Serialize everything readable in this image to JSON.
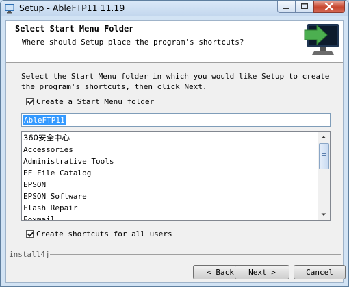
{
  "window": {
    "title": "Setup - AbleFTP11 11.19"
  },
  "header": {
    "title": "Select Start Menu Folder",
    "subtitle": "Where should Setup place the program's shortcuts?",
    "icon": "monitor-arrow-icon"
  },
  "body": {
    "description": "Select the Start Menu folder in which you would like Setup to create the program's shortcuts, then click Next.",
    "create_folder": {
      "label": "Create a Start Menu folder",
      "checked": true
    },
    "folder_name": "AbleFTP11",
    "folders": [
      "360安全中心",
      "Accessories",
      "Administrative Tools",
      "EF File Catalog",
      "EPSON",
      "EPSON Software",
      "Flash Repair",
      "Foxmail"
    ],
    "all_users": {
      "label": "Create shortcuts for all users",
      "checked": true
    }
  },
  "footer": {
    "brand": "install4j",
    "back_label": "< Back",
    "next_label": "Next >",
    "cancel_label": "Cancel"
  },
  "colors": {
    "selection": "#3399ff",
    "arrow_green": "#4caf50",
    "close_red": "#c7462f"
  }
}
